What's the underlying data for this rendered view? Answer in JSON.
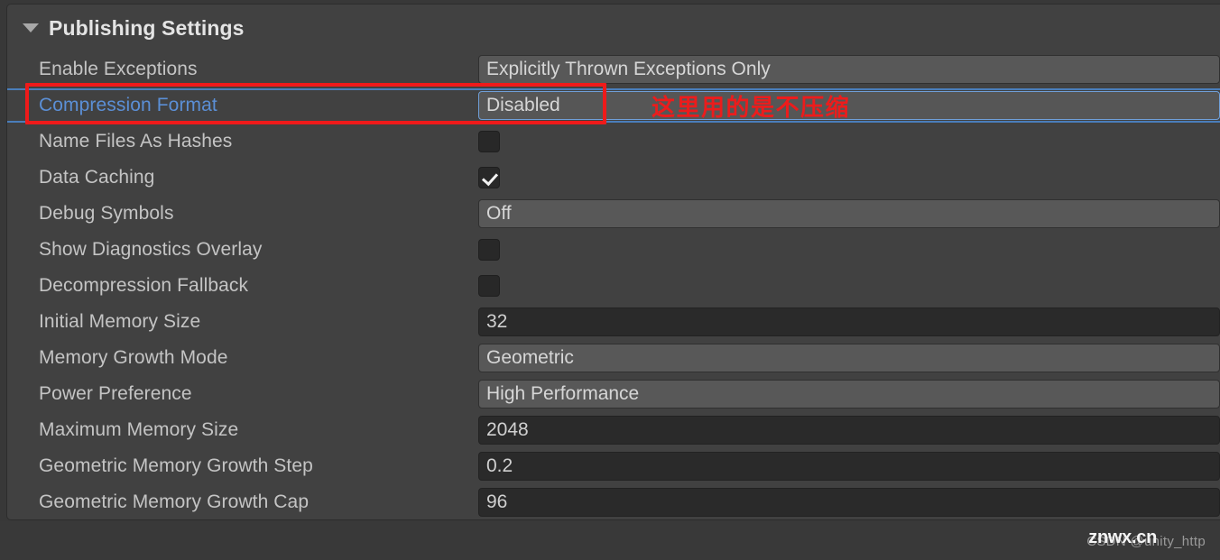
{
  "panel": {
    "title": "Publishing Settings",
    "foldout_icon": "triangle-down-icon",
    "expanded": true
  },
  "colors": {
    "panel_bg": "#414141",
    "dropdown_bg": "#585858",
    "textfield_bg": "#2a2a2a",
    "label": "#c4c4c4",
    "label_accent": "#5b8fd6",
    "annotation_red": "#ef1a1a",
    "focus_blue": "#4a7ebb"
  },
  "rows": [
    {
      "label": "Enable Exceptions",
      "type": "dropdown",
      "value": "Explicitly Thrown Exceptions Only",
      "name": "enable-exceptions"
    },
    {
      "label": "Compression Format",
      "type": "dropdown",
      "value": "Disabled",
      "name": "compression-format",
      "focused": true,
      "highlighted": true
    },
    {
      "label": "Name Files As Hashes",
      "type": "checkbox",
      "value": false,
      "name": "name-files-as-hashes"
    },
    {
      "label": "Data Caching",
      "type": "checkbox",
      "value": true,
      "name": "data-caching"
    },
    {
      "label": "Debug Symbols",
      "type": "dropdown",
      "value": "Off",
      "name": "debug-symbols"
    },
    {
      "label": "Show Diagnostics Overlay",
      "type": "checkbox",
      "value": false,
      "name": "show-diagnostics-overlay"
    },
    {
      "label": "Decompression Fallback",
      "type": "checkbox",
      "value": false,
      "name": "decompression-fallback"
    },
    {
      "label": "Initial Memory Size",
      "type": "textfield",
      "value": "32",
      "name": "initial-memory-size"
    },
    {
      "label": "Memory Growth Mode",
      "type": "dropdown",
      "value": "Geometric",
      "name": "memory-growth-mode"
    },
    {
      "label": "Power Preference",
      "type": "dropdown",
      "value": "High Performance",
      "name": "power-preference"
    },
    {
      "label": "Maximum Memory Size",
      "type": "textfield",
      "value": "2048",
      "name": "maximum-memory-size"
    },
    {
      "label": "Geometric Memory Growth Step",
      "type": "textfield",
      "value": "0.2",
      "name": "geometric-memory-growth-step"
    },
    {
      "label": "Geometric Memory Growth Cap",
      "type": "textfield",
      "value": "96",
      "name": "geometric-memory-growth-cap"
    }
  ],
  "annotations": {
    "chinese_note": "这里用的是不压缩",
    "red_box_target": "Compression Format"
  },
  "watermark": {
    "csdn": "CSDN @unity_http",
    "site": "znwx.cn"
  }
}
